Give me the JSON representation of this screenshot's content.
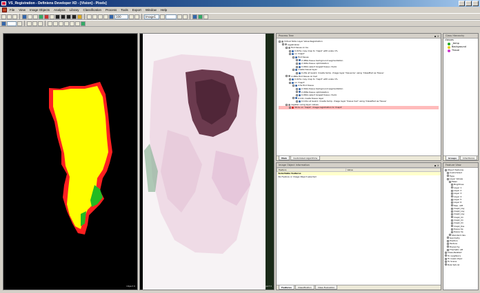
{
  "window": {
    "title": "VS_Registration - Definiens Developer XD - [Vision] - Pixels]"
  },
  "menu": [
    "File",
    "View",
    "Image Objects",
    "Analysis",
    "Library",
    "Classification",
    "Process",
    "Tools",
    "Export",
    "Window",
    "Help"
  ],
  "toolbar": {
    "zoom_value": "100",
    "layer_combo": "Image1"
  },
  "viewers": {
    "left_label": "Object 0",
    "right_label": "Object 0"
  },
  "process_tree": {
    "title": "Process Tree",
    "tabs": [
      "Main",
      "Customized Algorithms"
    ],
    "rows": [
      {
        "indent": 0,
        "text": "Virtual Slide Layer Value Registration"
      },
      {
        "indent": 1,
        "text": "registration"
      },
      {
        "indent": 2,
        "text": "find tissue on be"
      },
      {
        "indent": 3,
        "text": "0.015s   copy map to 'map2' with scale 1%"
      },
      {
        "indent": 3,
        "text": "on 'map2'"
      },
      {
        "indent": 4,
        "text": "find tissue"
      },
      {
        "indent": 5,
        "text": "2.489s   tissue background segmentation"
      },
      {
        "indent": 5,
        "text": "2.444s   tissue optimization"
      },
      {
        "indent": 5,
        "text": "0.062s   select largest tissue chunk"
      },
      {
        "indent": 4,
        "text": "create tissue layer"
      },
      {
        "indent": 5,
        "text": "0.20s    at  level1: Create temp. image layer 'tissue be' using 'Classified as Tissue'"
      },
      {
        "indent": 2,
        "text": "4.484s   find tissue on he2"
      },
      {
        "indent": 3,
        "text": "0.015s   copy map to 'map3' with scale 1%"
      },
      {
        "indent": 3,
        "text": "on 'map3'"
      },
      {
        "indent": 4,
        "text": "4.5s   find tissue"
      },
      {
        "indent": 5,
        "text": "2.342s   tissue background segmentation"
      },
      {
        "indent": 5,
        "text": "2.058s   tissue optimization"
      },
      {
        "indent": 5,
        "text": "0.062s   select largest tissue chunk"
      },
      {
        "indent": 4,
        "text": "0.141   create tissue layer"
      },
      {
        "indent": 5,
        "text": "0.141s   at  level1: Create temp. image layer 'tissue he2' using 'Classified as Tissue'"
      },
      {
        "indent": 2,
        "text": "register using layer values"
      },
      {
        "indent": 3,
        "text": "39.1s   on 'map2': image registration to 'map4'",
        "highlight": true
      }
    ]
  },
  "class_hierarchy": {
    "title": "Class Hierarchy",
    "root": "classes",
    "items": [
      {
        "name": "_temp",
        "color": "#22aa22"
      },
      {
        "name": "Background",
        "color": "#e6d020"
      },
      {
        "name": "Tissue",
        "color": "#cc33cc"
      }
    ],
    "tabs": [
      "Groups",
      "Inheritance"
    ]
  },
  "image_object_info": {
    "title": "Image Object Information",
    "columns": [
      "Feature",
      "Value"
    ],
    "section": "Selectable features",
    "message": "No Feature or Image Object selected",
    "tabs": [
      "Features",
      "Classification",
      "Class Evaluation"
    ]
  },
  "feature_view": {
    "title": "Feature View",
    "rows": [
      {
        "indent": 0,
        "text": "Object features"
      },
      {
        "indent": 1,
        "text": "Customized"
      },
      {
        "indent": 1,
        "text": "Type"
      },
      {
        "indent": 1,
        "text": "Layer Values"
      },
      {
        "indent": 2,
        "text": "Mean"
      },
      {
        "indent": 3,
        "text": "Brightnes"
      },
      {
        "indent": 3,
        "text": "Layer 1"
      },
      {
        "indent": 3,
        "text": "Layer 2"
      },
      {
        "indent": 3,
        "text": "Layer 3"
      },
      {
        "indent": 3,
        "text": "Layer 4"
      },
      {
        "indent": 3,
        "text": "Layer 5"
      },
      {
        "indent": 3,
        "text": "Layer 6"
      },
      {
        "indent": 3,
        "text": "Max. diff"
      },
      {
        "indent": 3,
        "text": "map2_Lay"
      },
      {
        "indent": 3,
        "text": "map2_Lay"
      },
      {
        "indent": 3,
        "text": "map2_Lay"
      },
      {
        "indent": 3,
        "text": "map2_Im"
      },
      {
        "indent": 3,
        "text": "map2_Im"
      },
      {
        "indent": 3,
        "text": "map2_Im"
      },
      {
        "indent": 3,
        "text": "map2_tiss"
      },
      {
        "indent": 3,
        "text": "tissue be"
      },
      {
        "indent": 3,
        "text": "tissue he"
      },
      {
        "indent": 2,
        "text": "Standard dev"
      },
      {
        "indent": 1,
        "text": "Geometry"
      },
      {
        "indent": 1,
        "text": "Position"
      },
      {
        "indent": 1,
        "text": "Texture"
      },
      {
        "indent": 1,
        "text": "Hierarchy"
      },
      {
        "indent": 1,
        "text": "Thematic att"
      },
      {
        "indent": 0,
        "text": "Class-Related"
      },
      {
        "indent": 0,
        "text": "To neighbors"
      },
      {
        "indent": 0,
        "text": "To super-objec"
      },
      {
        "indent": 0,
        "text": "To Scene"
      },
      {
        "indent": 0,
        "text": "Rule Set-rel"
      }
    ]
  }
}
